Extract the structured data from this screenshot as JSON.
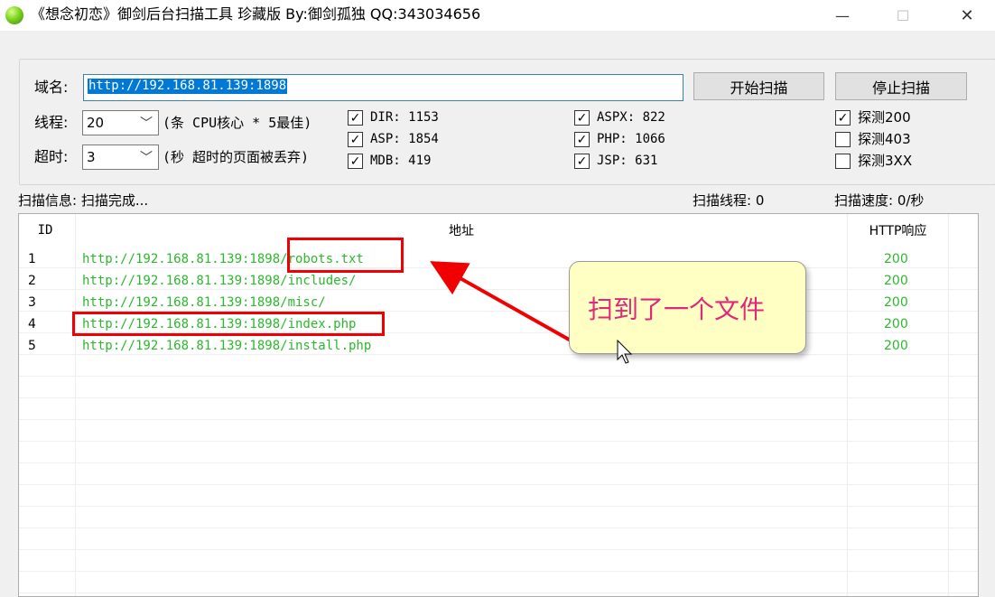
{
  "window": {
    "title": "《想念初恋》御剑后台扫描工具 珍藏版 By:御剑孤独 QQ:343034656",
    "minimize_glyph": "—",
    "maximize_glyph": "☐",
    "close_glyph": "✕"
  },
  "form": {
    "domain_label": "域名:",
    "domain_value": "http://192.168.81.139:1898",
    "threads_label": "线程:",
    "threads_value": "20",
    "threads_hint": "(条 CPU核心 * 5最佳)",
    "timeout_label": "超时:",
    "timeout_value": "3",
    "timeout_hint": "(秒 超时的页面被丢弃)",
    "start_button": "开始扫描",
    "stop_button": "停止扫描"
  },
  "dictionaries": [
    {
      "label": "DIR: 1153",
      "checked": true
    },
    {
      "label": "ASP: 1854",
      "checked": true
    },
    {
      "label": "MDB: 419",
      "checked": true
    },
    {
      "label": "ASPX: 822",
      "checked": true
    },
    {
      "label": "PHP: 1066",
      "checked": true
    },
    {
      "label": "JSP: 631",
      "checked": true
    }
  ],
  "probes": [
    {
      "label": "探测200",
      "checked": true
    },
    {
      "label": "探测403",
      "checked": false
    },
    {
      "label": "探测3XX",
      "checked": false
    }
  ],
  "checkmark": "✓",
  "status": {
    "info": "扫描信息: 扫描完成...",
    "threads": "扫描线程: 0",
    "speed": "扫描速度: 0/秒"
  },
  "table": {
    "columns": [
      "ID",
      "地址",
      "HTTP响应"
    ],
    "rows": [
      {
        "id": "1",
        "url": "http://192.168.81.139:1898/robots.txt",
        "code": "200"
      },
      {
        "id": "2",
        "url": "http://192.168.81.139:1898/includes/",
        "code": "200"
      },
      {
        "id": "3",
        "url": "http://192.168.81.139:1898/misc/",
        "code": "200"
      },
      {
        "id": "4",
        "url": "http://192.168.81.139:1898/index.php",
        "code": "200"
      },
      {
        "id": "5",
        "url": "http://192.168.81.139:1898/install.php",
        "code": "200"
      }
    ]
  },
  "annotation": {
    "callout_text": "扫到了一个文件",
    "color": "#f00000"
  }
}
